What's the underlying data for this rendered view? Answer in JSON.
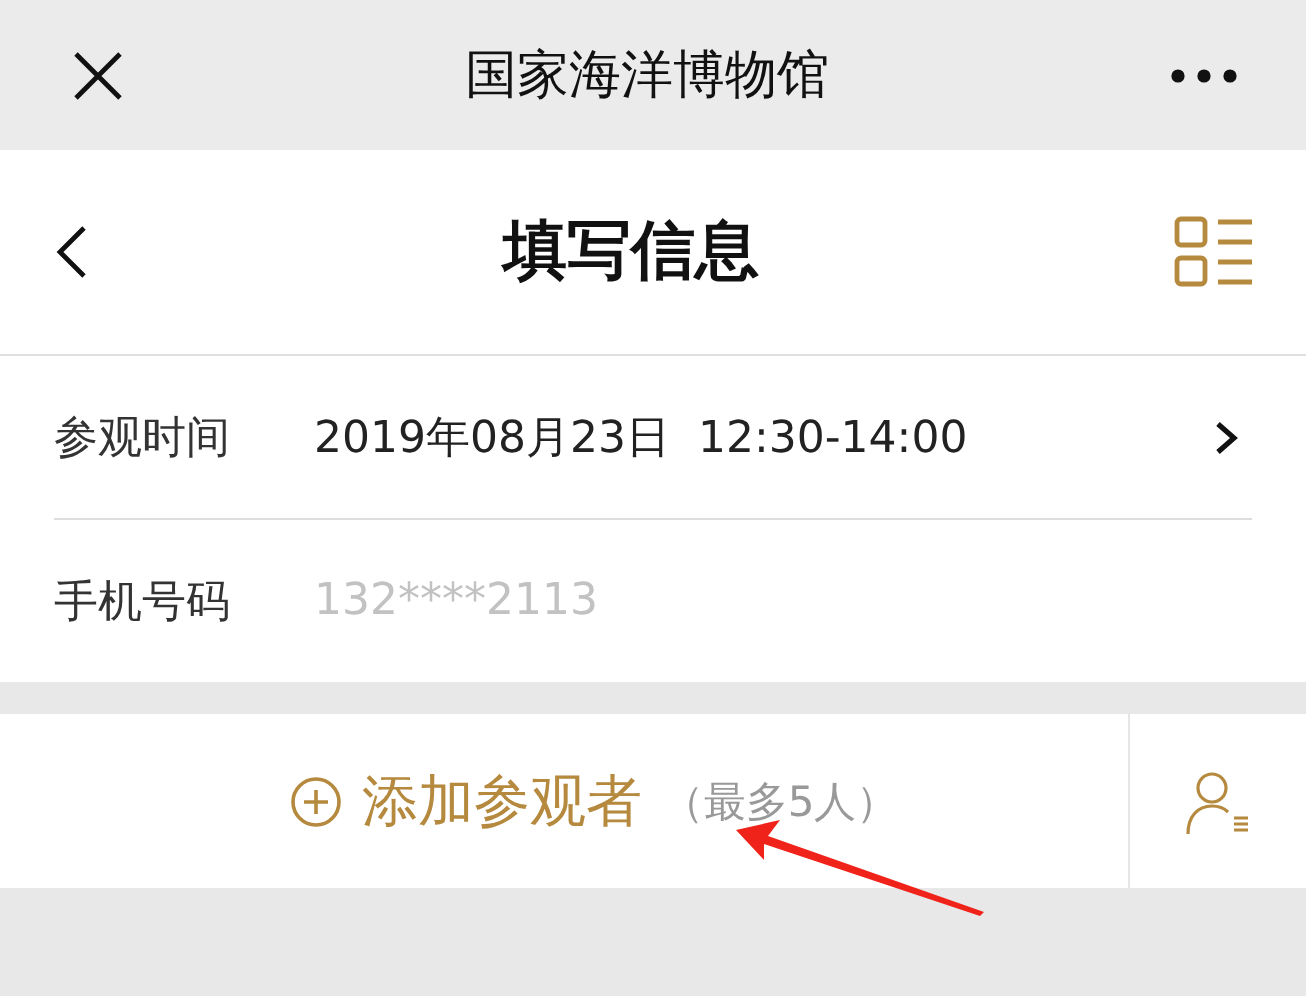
{
  "window": {
    "title": "国家海洋博物馆"
  },
  "header": {
    "title": "填写信息"
  },
  "fields": [
    {
      "kind": "select",
      "label": "参观时间",
      "value": "2019年08月23日  12:30-14:00"
    },
    {
      "kind": "input",
      "label": "手机号码",
      "value": "132****2113"
    }
  ],
  "add_visitor": {
    "label": "添加参观者",
    "hint": "（最多5人）"
  }
}
